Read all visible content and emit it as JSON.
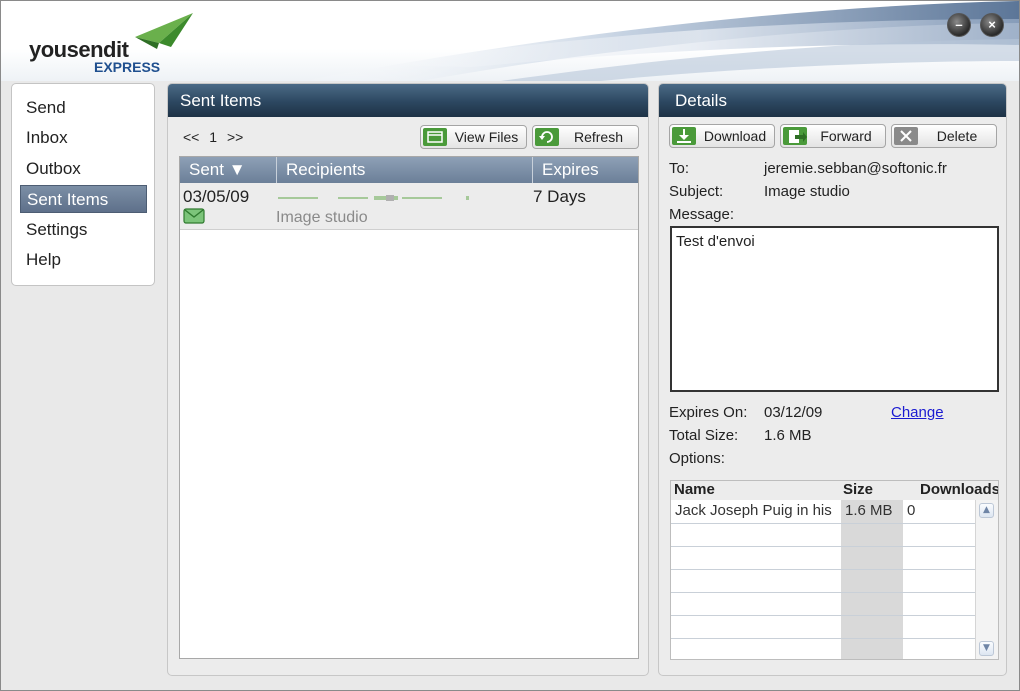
{
  "app": {
    "brand": "yousendit",
    "sub_brand": "EXPRESS",
    "window_buttons": [
      "minimize-icon",
      "close-icon"
    ]
  },
  "colors": {
    "header_bar": "#2c4760",
    "nav_active": "#5e708a",
    "button_icon_green": "#4a9a3a",
    "delete_icon_gray": "#8a8a8a",
    "link_blue": "#1b1bd1"
  },
  "nav": {
    "items": [
      {
        "label": "Send"
      },
      {
        "label": "Inbox"
      },
      {
        "label": "Outbox"
      },
      {
        "label": "Sent Items",
        "active": true
      },
      {
        "label": "Settings"
      },
      {
        "label": "Help"
      }
    ]
  },
  "sent_items": {
    "title": "Sent Items",
    "pager": {
      "prev": "<<",
      "page": "1",
      "next": ">>"
    },
    "view_files_label": "View Files",
    "refresh_label": "Refresh",
    "columns": {
      "sent": "Sent ▼",
      "recipients": "Recipients",
      "expires": "Expires"
    },
    "rows": [
      {
        "sent": "03/05/09",
        "recipients": "",
        "subject": "Image studio",
        "expires": "7 Days",
        "icon": "envelope-icon"
      }
    ]
  },
  "details": {
    "title": "Details",
    "download_label": "Download",
    "forward_label": "Forward",
    "delete_label": "Delete",
    "to_label": "To:",
    "to_value": "jeremie.sebban@softonic.fr",
    "subject_label": "Subject:",
    "subject_value": "Image studio",
    "message_label": "Message:",
    "message_value": "Test d'envoi",
    "expires_on_label": "Expires On:",
    "expires_on_value": "03/12/09",
    "change_link": "Change",
    "total_size_label": "Total Size:",
    "total_size_value": "1.6 MB",
    "options_label": "Options:",
    "files": {
      "columns": {
        "name": "Name",
        "size": "Size",
        "downloads": "Downloads"
      },
      "rows": [
        {
          "name": "Jack Joseph Puig in his",
          "size": "1.6 MB",
          "downloads": "0"
        }
      ]
    }
  }
}
